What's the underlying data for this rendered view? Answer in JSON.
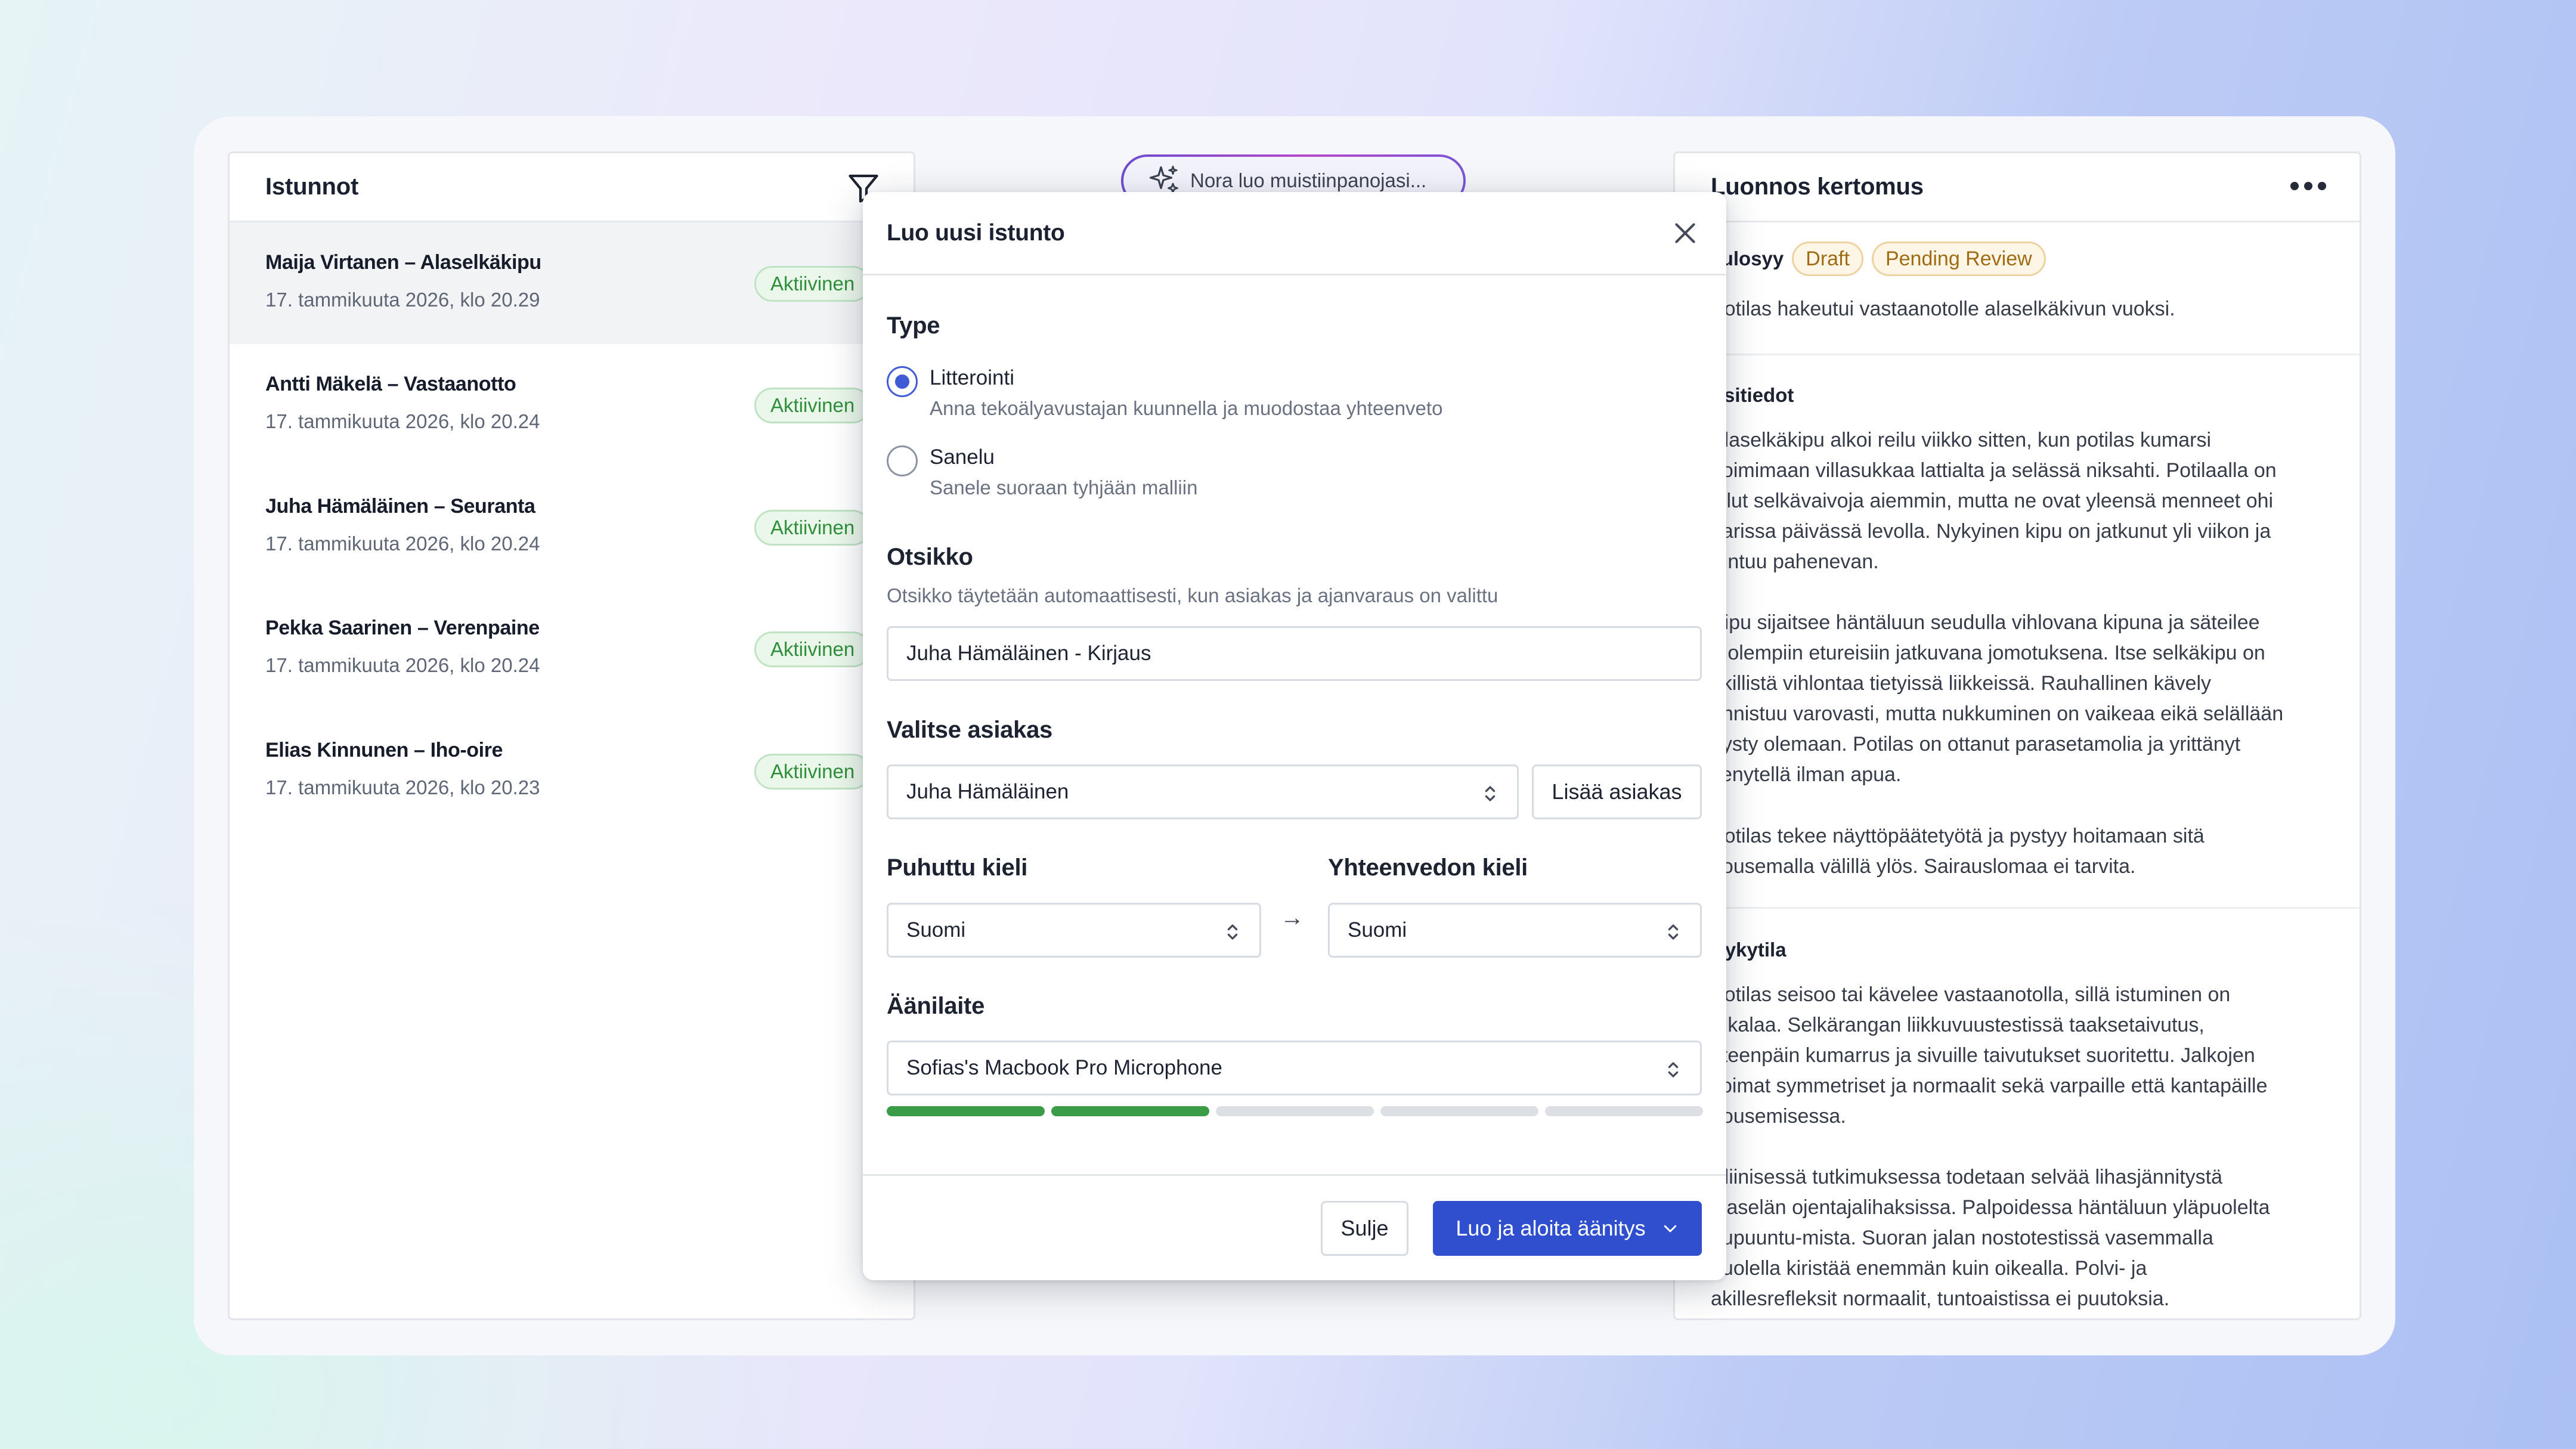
{
  "sessions_panel": {
    "title": "Istunnot",
    "items": [
      {
        "name": "Maija Virtanen – Alaselkäkipu",
        "date": "17. tammikuuta 2026, klo 20.29",
        "status": "Aktiivinen"
      },
      {
        "name": "Antti Mäkelä – Vastaanotto",
        "date": "17. tammikuuta 2026, klo 20.24",
        "status": "Aktiivinen"
      },
      {
        "name": "Juha Hämäläinen – Seuranta",
        "date": "17. tammikuuta 2026, klo 20.24",
        "status": "Aktiivinen"
      },
      {
        "name": "Pekka Saarinen – Verenpaine",
        "date": "17. tammikuuta 2026, klo 20.24",
        "status": "Aktiivinen"
      },
      {
        "name": "Elias Kinnunen – Iho-oire",
        "date": "17. tammikuuta 2026, klo 20.23",
        "status": "Aktiivinen"
      }
    ]
  },
  "nora_banner": {
    "text": "Nora luo muistiinpanojasi..."
  },
  "report_panel": {
    "title": "Luonnos kertomus",
    "reason_label": "Tulosyy",
    "tags": [
      "Draft",
      "Pending Review"
    ],
    "reason_text": "Potilas hakeutui vastaanotolle alaselkäkivun vuoksi.",
    "sections": [
      {
        "heading": "Esitiedot",
        "paragraphs": [
          [
            "Alaselkäkipu alkoi reilu viikko sitten, kun potilas kumarsi",
            "poimimaan villasukkaa lattialta ja selässä niksahti. Potilaalla on",
            "ollut selkävaivoja aiemmin, mutta ne ovat yleensä menneet ohi",
            "parissa päivässä levolla. Nykyinen kipu on jatkunut yli viikon ja",
            "tuntuu pahenevan."
          ],
          [
            "Kipu sijaitsee häntäluun seudulla vihlovana kipuna ja säteilee",
            "molempiin etureisiin jatkuvana jomotuksena. Itse selkäkipu on",
            "äkillistä vihlontaa tietyissä liikkeissä. Rauhallinen kävely",
            "onnistuu varovasti, mutta nukkuminen on vaikeaa eikä selällään",
            "pysty olemaan. Potilas on ottanut parasetamolia ja yrittänyt",
            "venytellä ilman apua."
          ],
          [
            "Potilas tekee näyttöpäätetyötä ja pystyy hoitamaan sitä",
            "nousemalla välillä ylös. Sairauslomaa ei tarvita."
          ]
        ]
      },
      {
        "heading": "Nykytila",
        "paragraphs": [
          [
            "Potilas seisoo tai kävelee vastaanotolla, sillä istuminen on",
            "tukalaa. Selkärangan liikkuvuustestissä taaksetaivutus,",
            "eteenpäin kumarrus ja sivuille taivutukset suoritettu. Jalkojen",
            "voimat symmetriset ja normaalit sekä varpaille että kantapäille",
            "nousemisessa."
          ],
          [
            "Kliinisessä tutkimuksessa todetaan selvää lihasjännitystä",
            "alaselän ojentajalihaksissa. Palpoidessa häntäluun yläpuolelta",
            "pupuuntu-mista. Suoran jalan nostotestissä vasemmalla",
            "puolella kiristää enemmän kuin oikealla. Polvi- ja",
            "akillesrefleksit normaalit, tuntoaistissa ei puutoksia."
          ]
        ]
      }
    ]
  },
  "modal": {
    "title": "Luo uusi istunto",
    "type_label": "Type",
    "options": [
      {
        "label": "Litterointi",
        "desc": "Anna tekoälyavustajan kuunnella ja muodostaa yhteenveto",
        "selected": true
      },
      {
        "label": "Sanelu",
        "desc": "Sanele suoraan tyhjään malliin",
        "selected": false
      }
    ],
    "title_label": "Otsikko",
    "title_help": "Otsikko täytetään automaattisesti, kun asiakas ja ajanvaraus on valittu",
    "title_value": "Juha Hämäläinen - Kirjaus",
    "client_label": "Valitse asiakas",
    "client_value": "Juha Hämäläinen",
    "add_client": "Lisää asiakas",
    "spoken_label": "Puhuttu kieli",
    "spoken_value": "Suomi",
    "arrow": "→",
    "summary_label": "Yhteenvedon kieli",
    "summary_value": "Suomi",
    "device_label": "Äänilaite",
    "device_value": "Sofias's Macbook Pro Microphone",
    "level_active": 2,
    "level_total": 5,
    "close_button": "Sulje",
    "create_button": "Luo ja aloita äänitys"
  },
  "colors": {
    "accent": "#2f4fcf",
    "active_green": "#3a9c46",
    "badge_draft": "#a06b12"
  }
}
